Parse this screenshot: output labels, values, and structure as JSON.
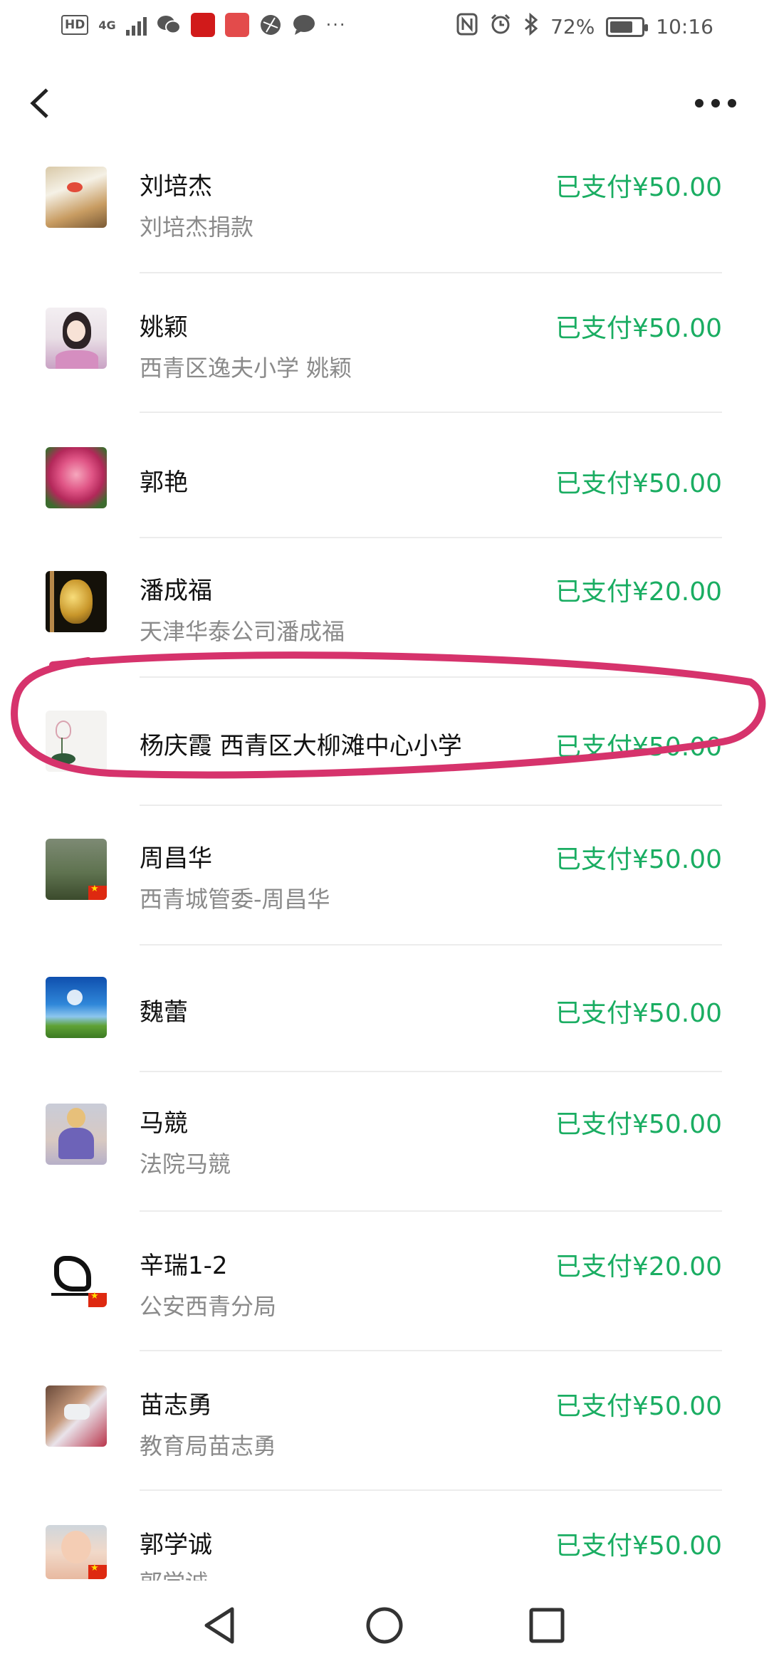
{
  "status_bar": {
    "left_badges": [
      "HD",
      "4G"
    ],
    "battery_percent": "72%",
    "battery_level": 0.72,
    "time": "10:16"
  },
  "colors": {
    "accent": "#1aad62",
    "annotation": "#d6336c"
  },
  "payments": [
    {
      "name": "刘培杰",
      "note": "刘培杰捐款",
      "amount": "已支付¥50.00"
    },
    {
      "name": "姚颖",
      "note": "西青区逸夫小学 姚颖",
      "amount": "已支付¥50.00"
    },
    {
      "name": "郭艳",
      "note": "",
      "amount": "已支付¥50.00"
    },
    {
      "name": "潘成福",
      "note": "天津华泰公司潘成福",
      "amount": "已支付¥20.00"
    },
    {
      "name": "杨庆霞  西青区大柳滩中心小学",
      "note": "",
      "amount": "已支付¥50.00"
    },
    {
      "name": "周昌华",
      "note": "西青城管委-周昌华",
      "amount": "已支付¥50.00"
    },
    {
      "name": "魏蕾",
      "note": "",
      "amount": "已支付¥50.00"
    },
    {
      "name": "马競",
      "note": "法院马競",
      "amount": "已支付¥50.00"
    },
    {
      "name": "辛瑞1-2",
      "note": "公安西青分局",
      "amount": "已支付¥20.00"
    },
    {
      "name": "苗志勇",
      "note": "教育局苗志勇",
      "amount": "已支付¥50.00"
    },
    {
      "name": "郭学诚",
      "note": "郭学诚",
      "amount": "已支付¥50.00"
    }
  ]
}
